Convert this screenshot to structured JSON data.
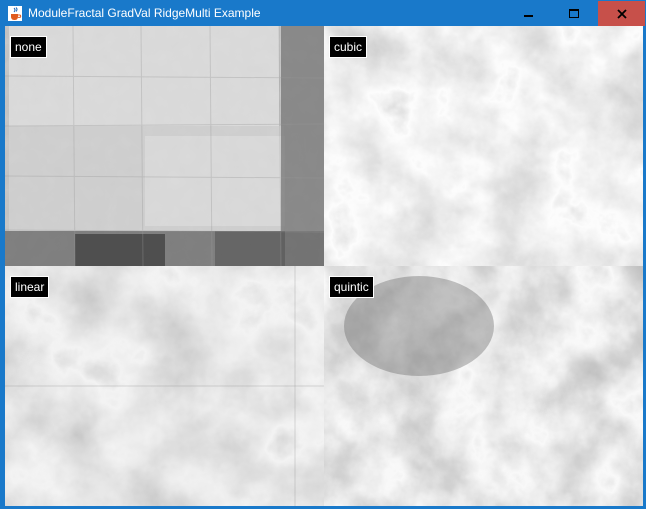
{
  "window": {
    "title": "ModuleFractal GradVal RidgeMulti Example",
    "app_icon": "java-cup-icon",
    "controls": {
      "minimize_icon": "minimize-icon",
      "maximize_icon": "maximize-icon",
      "close_icon": "close-icon"
    },
    "accent_color": "#1979ca",
    "close_color": "#c7504a"
  },
  "panels": [
    {
      "label": "none"
    },
    {
      "label": "cubic"
    },
    {
      "label": "linear"
    },
    {
      "label": "quintic"
    }
  ]
}
